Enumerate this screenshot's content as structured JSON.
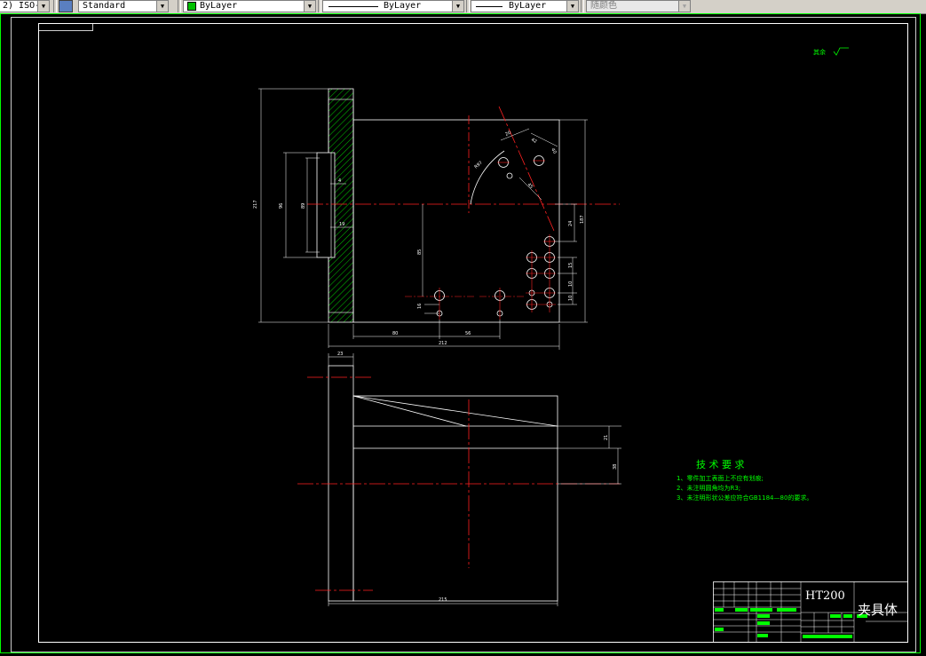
{
  "toolbar": {
    "dimstyle_value": "2) ISO-",
    "textstyle_value": "Standard",
    "layer_value": "ByLayer",
    "linetype_value": "ByLayer",
    "lineweight_value": "ByLayer",
    "plotstyle_value": "随颜色"
  },
  "drawing": {
    "roughness_note": "其余",
    "dims": {
      "d217": "217",
      "d96": "96",
      "d89": "89",
      "d4": "4",
      "d19": "19",
      "d85": "85",
      "d16": "16",
      "d80": "80",
      "d56": "56",
      "d212": "212",
      "d187": "187",
      "d24": "24",
      "d15": "15",
      "d10a": "10",
      "d10b": "10",
      "d20": "20",
      "d42": "42",
      "d40": "40",
      "dR": "R97",
      "d45": "45",
      "d23": "23",
      "d21": "21",
      "d38": "38",
      "d215": "215"
    },
    "tech_req": {
      "title": "技 术 要 求",
      "items": [
        "1、零件加工表面上不应有划痕;",
        "2、未注明圆角均为R3;",
        "3、未注明形状公差应符合GB1184—80的要求。"
      ]
    },
    "title_block": {
      "material": "HT200",
      "part_name": "夹具体"
    }
  }
}
